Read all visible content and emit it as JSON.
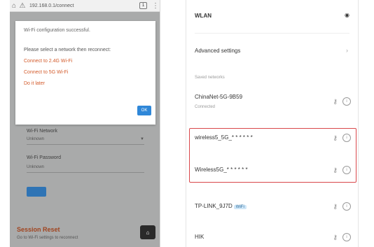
{
  "left_phone": {
    "browser_bar": {
      "url": "192.168.0.1/connect"
    },
    "dialog": {
      "message": "Wi-Fi configuration successful.",
      "question": "Please select a network then reconnect:",
      "options": [
        "Connect to 2.4G Wi-Fi",
        "Connect to 5G Wi-Fi",
        "Do it later"
      ],
      "ok_label": "OK"
    },
    "under": {
      "field1_label": "Wi-Fi Network",
      "field1_value": "Unknown",
      "field2_label": "Wi-Fi Password",
      "field2_value": "Unknown",
      "section_title": "Session Reset",
      "section_sub": "Go to Wi-Fi settings to reconnect"
    }
  },
  "right_phone": {
    "wlan_label": "WLAN",
    "advanced_label": "Advanced settings",
    "section_header": "Saved networks",
    "current_net": {
      "name": "ChinaNet-5G-9B59",
      "status": "Connected"
    },
    "highlighted_networks": [
      {
        "name": "wireless5_5G_* * * * * *"
      },
      {
        "name": "Wireless5G_* * * * * *"
      }
    ],
    "other_networks": [
      {
        "name": "TP-LINK_9J7D",
        "tag": "WiFi"
      },
      {
        "name": "HIK"
      }
    ]
  },
  "colors": {
    "dialog_link": "#d35a2a",
    "ok_button": "#2f87d8",
    "highlight_border": "#d9474b",
    "overlay_gray": "#a9aaaa"
  }
}
